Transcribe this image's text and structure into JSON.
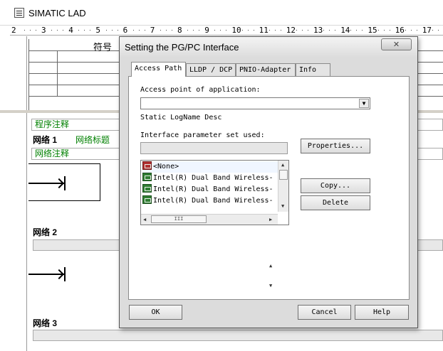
{
  "app": {
    "title": "SIMATIC LAD"
  },
  "ruler": {
    "start": "2",
    "numbers": [
      "3",
      "4",
      "5",
      "6",
      "7",
      "8",
      "9",
      "10",
      "11",
      "12",
      "13",
      "14",
      "15",
      "16",
      "17"
    ]
  },
  "symbol_table": {
    "header": "符号"
  },
  "editor": {
    "program_comment": "程序注释",
    "network1": {
      "title": "网络 1",
      "heading": "网络标题",
      "comment": "网络注释"
    },
    "network2": {
      "title": "网络 2"
    },
    "network3": {
      "title": "网络 3"
    }
  },
  "dialog": {
    "title": "Setting the PG/PC Interface",
    "close": "✕",
    "tabs": [
      {
        "label": "Access Path",
        "active": true
      },
      {
        "label": "LLDP / DCP",
        "active": false
      },
      {
        "label": "PNIO-Adapter",
        "active": false
      },
      {
        "label": "Info",
        "active": false
      }
    ],
    "access_point_label": "Access point of application:",
    "access_point_value": "",
    "static_logname": "Static LogName Desc",
    "param_set_label": "Interface parameter set used:",
    "param_set_value": "",
    "properties_button": "Properties...",
    "interface_list": [
      "<None>",
      "Intel(R) Dual Band Wireless-",
      "Intel(R) Dual Band Wireless-",
      "Intel(R) Dual Band Wireless-"
    ],
    "copy_button": "Copy...",
    "delete_button": "Delete",
    "ok_button": "OK",
    "cancel_button": "Cancel",
    "help_button": "Help",
    "hscroll_grip": "III"
  }
}
